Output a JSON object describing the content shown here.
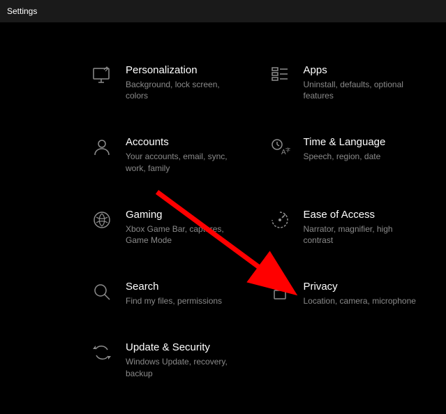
{
  "window": {
    "title": "Settings"
  },
  "categories": [
    {
      "title": "Personalization",
      "desc": "Background, lock screen, colors"
    },
    {
      "title": "Apps",
      "desc": "Uninstall, defaults, optional features"
    },
    {
      "title": "Accounts",
      "desc": "Your accounts, email, sync, work, family"
    },
    {
      "title": "Time & Language",
      "desc": "Speech, region, date"
    },
    {
      "title": "Gaming",
      "desc": "Xbox Game Bar, captures, Game Mode"
    },
    {
      "title": "Ease of Access",
      "desc": "Narrator, magnifier, high contrast"
    },
    {
      "title": "Search",
      "desc": "Find my files, permissions"
    },
    {
      "title": "Privacy",
      "desc": "Location, camera, microphone"
    },
    {
      "title": "Update & Security",
      "desc": "Windows Update, recovery, backup"
    }
  ]
}
